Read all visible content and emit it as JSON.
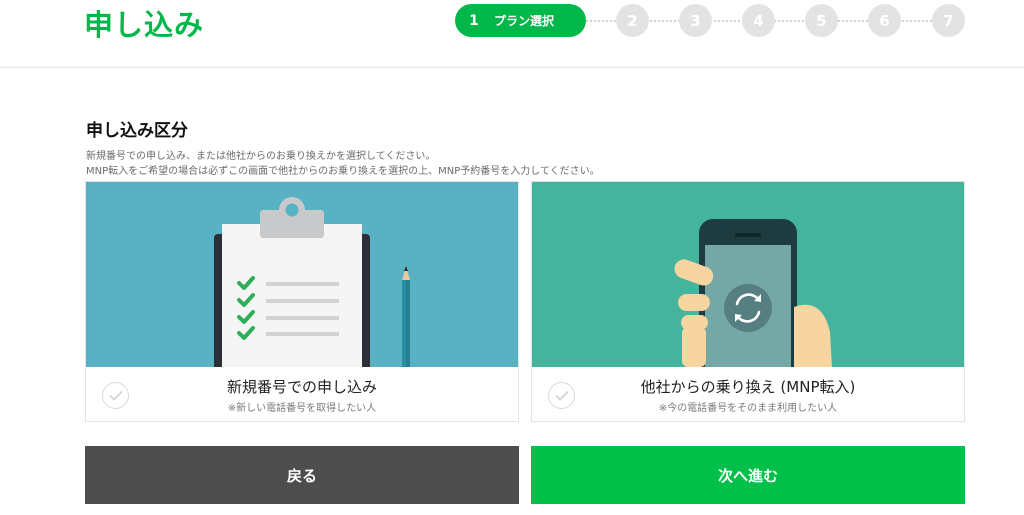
{
  "header": {
    "title": "申し込み",
    "active_step": {
      "number": "1",
      "label": "プラン選択"
    },
    "steps": [
      "2",
      "3",
      "4",
      "5",
      "6",
      "7"
    ]
  },
  "section": {
    "title": "申し込み区分",
    "desc_line1": "新規番号での申し込み、または他社からのお乗り換えかを選択してください。",
    "desc_line2": "MNP転入をご希望の場合は必ずこの画面で他社からのお乗り換えを選択の上、MNP予約番号を入力してください。"
  },
  "options": {
    "new": {
      "title": "新規番号での申し込み",
      "sub": "※新しい電話番号を取得したい人",
      "icon": "clipboard-checklist-illustration"
    },
    "mnp": {
      "title": "他社からの乗り換え (MNP転入)",
      "sub": "※今の電話番号をそのまま利用したい人",
      "icon": "phone-switch-illustration"
    }
  },
  "buttons": {
    "back": "戻る",
    "next": "次へ進む"
  },
  "colors": {
    "brand_green": "#00b84a",
    "card_blue": "#59b2c3",
    "card_teal": "#45b49d",
    "back_gray": "#4d4d4d"
  }
}
